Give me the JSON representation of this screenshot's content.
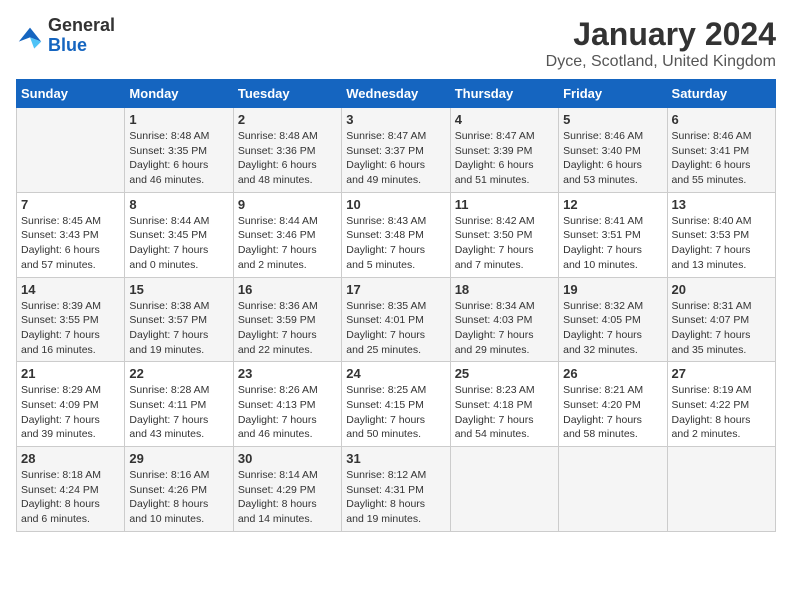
{
  "header": {
    "logo_general": "General",
    "logo_blue": "Blue",
    "month_year": "January 2024",
    "location": "Dyce, Scotland, United Kingdom"
  },
  "days_of_week": [
    "Sunday",
    "Monday",
    "Tuesday",
    "Wednesday",
    "Thursday",
    "Friday",
    "Saturday"
  ],
  "weeks": [
    [
      {
        "day": "",
        "info": ""
      },
      {
        "day": "1",
        "info": "Sunrise: 8:48 AM\nSunset: 3:35 PM\nDaylight: 6 hours\nand 46 minutes."
      },
      {
        "day": "2",
        "info": "Sunrise: 8:48 AM\nSunset: 3:36 PM\nDaylight: 6 hours\nand 48 minutes."
      },
      {
        "day": "3",
        "info": "Sunrise: 8:47 AM\nSunset: 3:37 PM\nDaylight: 6 hours\nand 49 minutes."
      },
      {
        "day": "4",
        "info": "Sunrise: 8:47 AM\nSunset: 3:39 PM\nDaylight: 6 hours\nand 51 minutes."
      },
      {
        "day": "5",
        "info": "Sunrise: 8:46 AM\nSunset: 3:40 PM\nDaylight: 6 hours\nand 53 minutes."
      },
      {
        "day": "6",
        "info": "Sunrise: 8:46 AM\nSunset: 3:41 PM\nDaylight: 6 hours\nand 55 minutes."
      }
    ],
    [
      {
        "day": "7",
        "info": "Sunrise: 8:45 AM\nSunset: 3:43 PM\nDaylight: 6 hours\nand 57 minutes."
      },
      {
        "day": "8",
        "info": "Sunrise: 8:44 AM\nSunset: 3:45 PM\nDaylight: 7 hours\nand 0 minutes."
      },
      {
        "day": "9",
        "info": "Sunrise: 8:44 AM\nSunset: 3:46 PM\nDaylight: 7 hours\nand 2 minutes."
      },
      {
        "day": "10",
        "info": "Sunrise: 8:43 AM\nSunset: 3:48 PM\nDaylight: 7 hours\nand 5 minutes."
      },
      {
        "day": "11",
        "info": "Sunrise: 8:42 AM\nSunset: 3:50 PM\nDaylight: 7 hours\nand 7 minutes."
      },
      {
        "day": "12",
        "info": "Sunrise: 8:41 AM\nSunset: 3:51 PM\nDaylight: 7 hours\nand 10 minutes."
      },
      {
        "day": "13",
        "info": "Sunrise: 8:40 AM\nSunset: 3:53 PM\nDaylight: 7 hours\nand 13 minutes."
      }
    ],
    [
      {
        "day": "14",
        "info": "Sunrise: 8:39 AM\nSunset: 3:55 PM\nDaylight: 7 hours\nand 16 minutes."
      },
      {
        "day": "15",
        "info": "Sunrise: 8:38 AM\nSunset: 3:57 PM\nDaylight: 7 hours\nand 19 minutes."
      },
      {
        "day": "16",
        "info": "Sunrise: 8:36 AM\nSunset: 3:59 PM\nDaylight: 7 hours\nand 22 minutes."
      },
      {
        "day": "17",
        "info": "Sunrise: 8:35 AM\nSunset: 4:01 PM\nDaylight: 7 hours\nand 25 minutes."
      },
      {
        "day": "18",
        "info": "Sunrise: 8:34 AM\nSunset: 4:03 PM\nDaylight: 7 hours\nand 29 minutes."
      },
      {
        "day": "19",
        "info": "Sunrise: 8:32 AM\nSunset: 4:05 PM\nDaylight: 7 hours\nand 32 minutes."
      },
      {
        "day": "20",
        "info": "Sunrise: 8:31 AM\nSunset: 4:07 PM\nDaylight: 7 hours\nand 35 minutes."
      }
    ],
    [
      {
        "day": "21",
        "info": "Sunrise: 8:29 AM\nSunset: 4:09 PM\nDaylight: 7 hours\nand 39 minutes."
      },
      {
        "day": "22",
        "info": "Sunrise: 8:28 AM\nSunset: 4:11 PM\nDaylight: 7 hours\nand 43 minutes."
      },
      {
        "day": "23",
        "info": "Sunrise: 8:26 AM\nSunset: 4:13 PM\nDaylight: 7 hours\nand 46 minutes."
      },
      {
        "day": "24",
        "info": "Sunrise: 8:25 AM\nSunset: 4:15 PM\nDaylight: 7 hours\nand 50 minutes."
      },
      {
        "day": "25",
        "info": "Sunrise: 8:23 AM\nSunset: 4:18 PM\nDaylight: 7 hours\nand 54 minutes."
      },
      {
        "day": "26",
        "info": "Sunrise: 8:21 AM\nSunset: 4:20 PM\nDaylight: 7 hours\nand 58 minutes."
      },
      {
        "day": "27",
        "info": "Sunrise: 8:19 AM\nSunset: 4:22 PM\nDaylight: 8 hours\nand 2 minutes."
      }
    ],
    [
      {
        "day": "28",
        "info": "Sunrise: 8:18 AM\nSunset: 4:24 PM\nDaylight: 8 hours\nand 6 minutes."
      },
      {
        "day": "29",
        "info": "Sunrise: 8:16 AM\nSunset: 4:26 PM\nDaylight: 8 hours\nand 10 minutes."
      },
      {
        "day": "30",
        "info": "Sunrise: 8:14 AM\nSunset: 4:29 PM\nDaylight: 8 hours\nand 14 minutes."
      },
      {
        "day": "31",
        "info": "Sunrise: 8:12 AM\nSunset: 4:31 PM\nDaylight: 8 hours\nand 19 minutes."
      },
      {
        "day": "",
        "info": ""
      },
      {
        "day": "",
        "info": ""
      },
      {
        "day": "",
        "info": ""
      }
    ]
  ]
}
